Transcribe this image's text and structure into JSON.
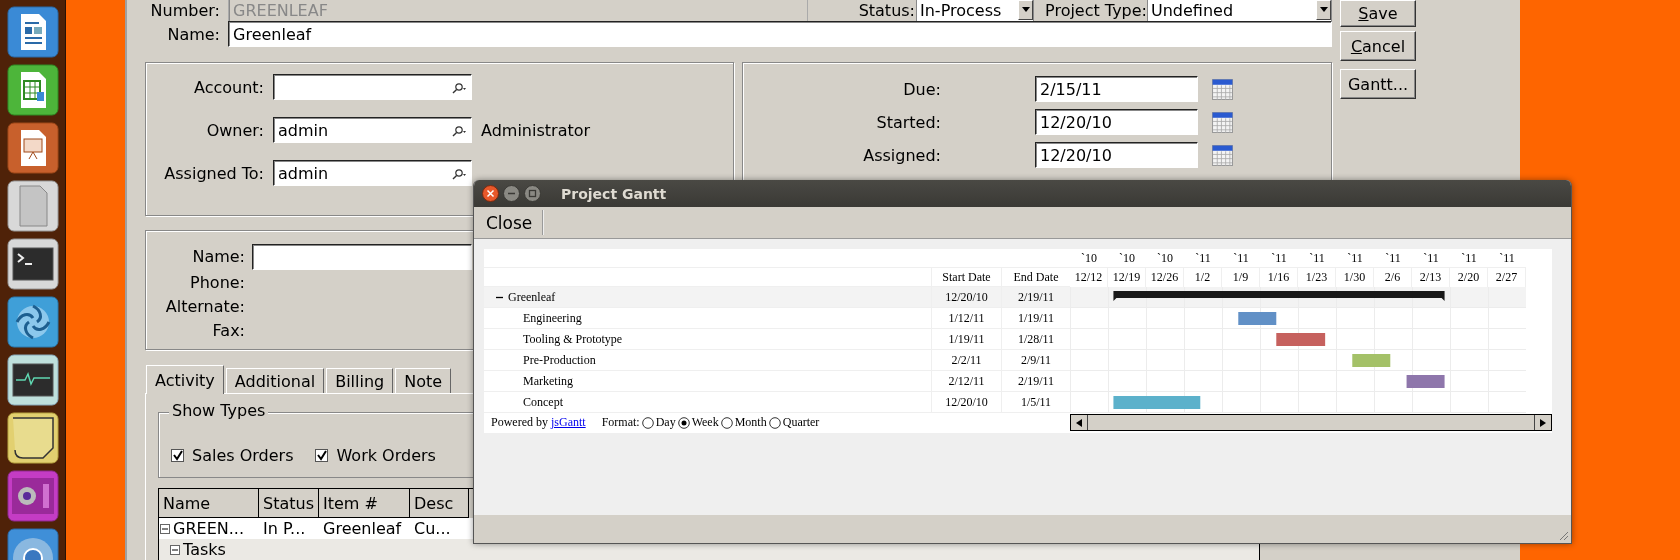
{
  "launcher": [
    {
      "kind": "writer"
    },
    {
      "kind": "calc"
    },
    {
      "kind": "impress"
    },
    {
      "kind": "office"
    },
    {
      "kind": "terminal"
    },
    {
      "kind": "shutter"
    },
    {
      "kind": "monitor"
    },
    {
      "kind": "notes"
    },
    {
      "kind": "camera"
    },
    {
      "kind": "browser"
    }
  ],
  "form": {
    "number_label": "Number:",
    "number_value": "GREENLEAF",
    "status_label": "Status:",
    "status_value": "In-Process",
    "project_type_label": "Project Type:",
    "project_type_value": "Undefined",
    "name_label": "Name:",
    "name_value": "Greenleaf",
    "buttons": [
      {
        "accel": "S",
        "rest": "ave"
      },
      {
        "accel": "C",
        "rest": "ancel"
      },
      {
        "rest": "Gantt..."
      }
    ],
    "people": [
      {
        "label": "Account:"
      },
      {
        "label": "Owner:",
        "value": "admin",
        "extra": "Administrator"
      },
      {
        "label": "Assigned To:",
        "value": "admin"
      }
    ],
    "dates": [
      {
        "label": "Due:",
        "value": "2/15/11"
      },
      {
        "label": "Started:",
        "value": "12/20/10"
      },
      {
        "label": "Assigned:",
        "value": "12/20/10"
      }
    ],
    "contact": [
      {
        "label": "Name:",
        "kind": "field"
      },
      {
        "label": "Phone:",
        "kind": "text"
      },
      {
        "label": "Alternate:",
        "kind": "text"
      },
      {
        "label": "Fax:",
        "kind": "text"
      }
    ],
    "tabs": [
      {
        "label": "Activity",
        "selected": true
      },
      {
        "label": "Additional",
        "selected": false
      },
      {
        "label": "Billing",
        "selected": false
      },
      {
        "label": "Note",
        "selected": false
      }
    ],
    "show_types": {
      "title": "Show Types",
      "options": [
        {
          "label": "Sales Orders",
          "checked": true
        },
        {
          "label": "Work Orders",
          "checked": true
        }
      ]
    },
    "table": {
      "columns": [
        "Name",
        "Status",
        "Item #",
        "Desc"
      ],
      "rows": [
        {
          "cells": [
            "GREEN...",
            "In P...",
            "Greenleaf",
            "Cu..."
          ],
          "expanded": true,
          "children": [
            {
              "cells": [
                "Tasks"
              ],
              "expanded": true
            }
          ]
        }
      ]
    }
  },
  "gantt": {
    "title": "Project Gantt",
    "toolbar": [
      "Close"
    ],
    "columns": [
      "Start Date",
      "End Date"
    ],
    "years": [
      "`10",
      "`10",
      "`10",
      "`11",
      "`11",
      "`11",
      "`11",
      "`11",
      "`11",
      "`11",
      "`11",
      "`11"
    ],
    "weeks": [
      "12/12",
      "12/19",
      "12/26",
      "1/2",
      "1/9",
      "1/16",
      "1/23",
      "1/30",
      "2/6",
      "2/13",
      "2/20",
      "2/27"
    ],
    "tasks": [
      {
        "name": "Greenleaf",
        "start": "12/20/10",
        "end": "2/19/11",
        "kind": "group",
        "expanded": true,
        "children": [
          {
            "name": "Engineering",
            "start": "1/12/11",
            "end": "1/19/11",
            "kind": "task",
            "color": "#6190c6"
          },
          {
            "name": "Tooling & Prototype",
            "start": "1/19/11",
            "end": "1/28/11",
            "kind": "task",
            "color": "#c6615e"
          },
          {
            "name": "Pre-Production",
            "start": "2/2/11",
            "end": "2/9/11",
            "kind": "task",
            "color": "#a4c168"
          },
          {
            "name": "Marketing",
            "start": "2/12/11",
            "end": "2/19/11",
            "kind": "task",
            "color": "#8e76ab"
          },
          {
            "name": "Concept",
            "start": "12/20/10",
            "end": "1/5/11",
            "kind": "task",
            "color": "#5cb1cb"
          }
        ]
      }
    ],
    "powered_by": "Powered by",
    "link": "jsGantt",
    "format_label": "Format:",
    "formats": [
      {
        "label": "Day",
        "selected": false
      },
      {
        "label": "Week",
        "selected": true
      },
      {
        "label": "Month",
        "selected": false
      },
      {
        "label": "Quarter",
        "selected": false
      }
    ]
  }
}
